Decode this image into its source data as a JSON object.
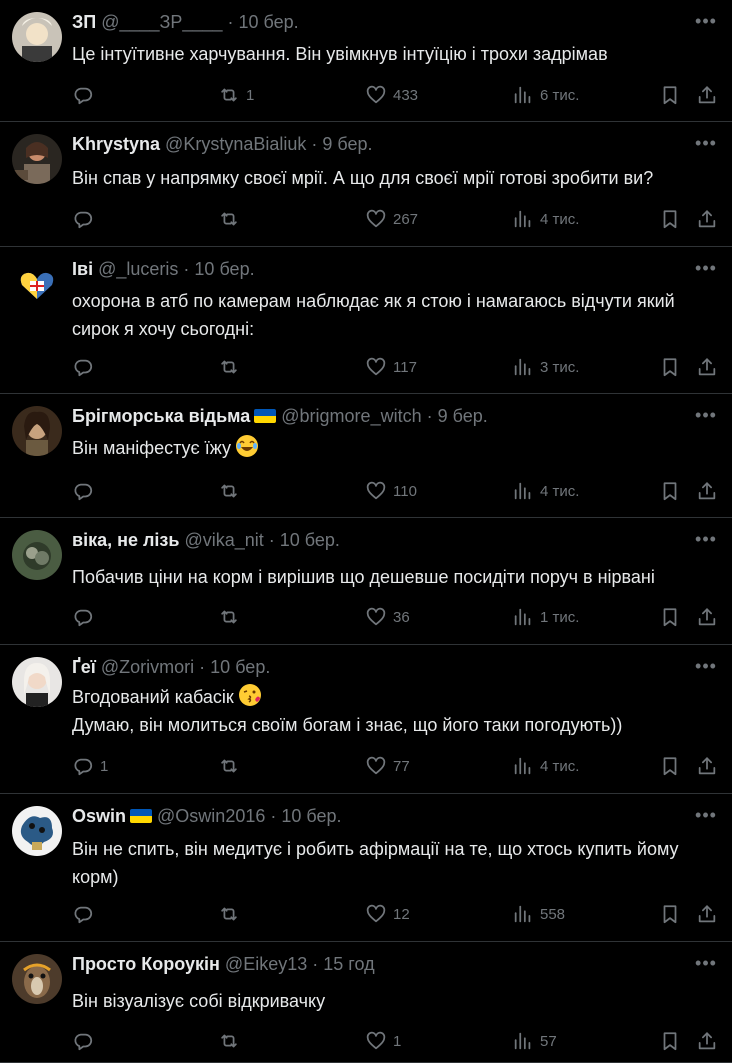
{
  "tweets": [
    {
      "name": "ЗП",
      "handle": "@____ЗР____",
      "dot": "·",
      "time": "10 бер.",
      "lines": [
        "Це інтуїтивне харчування. Він увімкнув інтуїцію і трохи задрімав"
      ],
      "replies": "",
      "retweets": "1",
      "likes": "433",
      "views": "6 тис.",
      "avatar": "avatar-zp"
    },
    {
      "name": "Khrystyna",
      "handle": "@KrystynaBialiuk",
      "dot": "·",
      "time": "9 бер.",
      "lines": [
        "Він спав у напрямку своєї мрії. А що для своєї мрії готові зробити ви?"
      ],
      "replies": "",
      "retweets": "",
      "likes": "267",
      "views": "4 тис.",
      "avatar": "avatar-khrystyna"
    },
    {
      "name": "Іві",
      "handle": "@_luceris",
      "dot": "·",
      "time": "10 бер.",
      "lines": [
        "охорона в атб по камерам наблюдає як я стою і намагаюсь відчути який",
        "сирок я хочу сьогодні:"
      ],
      "replies": "",
      "retweets": "",
      "likes": "117",
      "views": "3 тис.",
      "avatar": "avatar-ivi"
    },
    {
      "name": "Брігморська відьма",
      "handle": "@brigmore_witch",
      "dot": "·",
      "time": "9 бер.",
      "lines": [
        "Він маніфестує їжу"
      ],
      "replies": "",
      "retweets": "",
      "likes": "110",
      "views": "4 тис.",
      "avatar": "avatar-witch",
      "flag": true,
      "emoji": "laugh-emoji"
    },
    {
      "name": "віка, не лізь",
      "handle": "@vika_nit",
      "dot": "·",
      "time": "10 бер.",
      "lines": [
        "Побачив ціни на корм і вирішив що дешевше посидіти поруч в нірвані"
      ],
      "replies": "",
      "retweets": "",
      "likes": "36",
      "views": "1 тис.",
      "avatar": "avatar-vika"
    },
    {
      "name": "Ґеї",
      "handle": "@Zorivmori",
      "dot": "·",
      "time": "10 бер.",
      "lines": [
        "Вгодований кабасік",
        "Думаю, він молиться своїм богам і знає, що його таки погодують))"
      ],
      "replies": "1",
      "retweets": "",
      "likes": "77",
      "views": "4 тис.",
      "avatar": "avatar-gei",
      "emoji": "kiss-emoji"
    },
    {
      "name": "Oswin",
      "handle": "@Oswin2016",
      "dot": "·",
      "time": "10 бер.",
      "lines": [
        "Він не спить, він медитує і робить афірмації на те, що хтось купить йому",
        "корм)"
      ],
      "replies": "",
      "retweets": "",
      "likes": "12",
      "views": "558",
      "avatar": "avatar-oswin",
      "flag": true
    },
    {
      "name": "Просто Короукін",
      "handle": "@Eikey13",
      "dot": "·",
      "time": "15 год",
      "lines": [
        "Він візуалізує собі відкривачку"
      ],
      "replies": "",
      "retweets": "",
      "likes": "1",
      "views": "57",
      "avatar": "avatar-koroukin"
    }
  ],
  "colors": {
    "background": "#000000",
    "text": "#e7e9ea",
    "muted": "#71767b",
    "divider": "#2f3336",
    "flag_blue": "#0057b7",
    "flag_yellow": "#ffd700"
  },
  "icons": [
    "reply-icon",
    "retweet-icon",
    "like-icon",
    "views-icon",
    "bookmark-icon",
    "share-icon",
    "more-icon"
  ]
}
